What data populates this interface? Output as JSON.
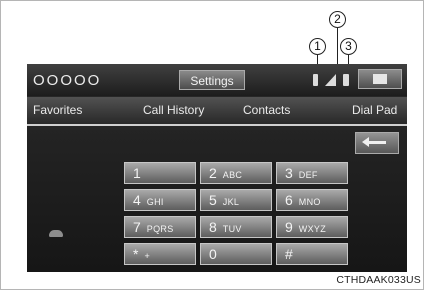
{
  "callouts": [
    "1",
    "2",
    "3"
  ],
  "screen": {
    "brand": "OOOOO",
    "settings_label": "Settings",
    "tabs": [
      "Favorites",
      "Call History",
      "Contacts",
      "Dial Pad"
    ],
    "keypad": [
      {
        "digit": "1",
        "letters": ""
      },
      {
        "digit": "2",
        "letters": "ABC"
      },
      {
        "digit": "3",
        "letters": "DEF"
      },
      {
        "digit": "4",
        "letters": "GHI"
      },
      {
        "digit": "5",
        "letters": "JKL"
      },
      {
        "digit": "6",
        "letters": "MNO"
      },
      {
        "digit": "7",
        "letters": "PQRS"
      },
      {
        "digit": "8",
        "letters": "TUV"
      },
      {
        "digit": "9",
        "letters": "WXYZ"
      },
      {
        "digit": "*",
        "letters": "+"
      },
      {
        "digit": "0",
        "letters": ""
      },
      {
        "digit": "#",
        "letters": ""
      }
    ]
  },
  "caption": "CTHDAAK033US",
  "icons": [
    "bluetooth-icon",
    "signal-strength-icon",
    "battery-icon",
    "mail-icon",
    "back-arrow-icon",
    "phone-icon"
  ],
  "colors": {
    "screen_bg": "#1c1c1c",
    "key_top": "#aaaaaa",
    "key_bottom": "#5d5d5d",
    "text": "#f4f4f4"
  }
}
